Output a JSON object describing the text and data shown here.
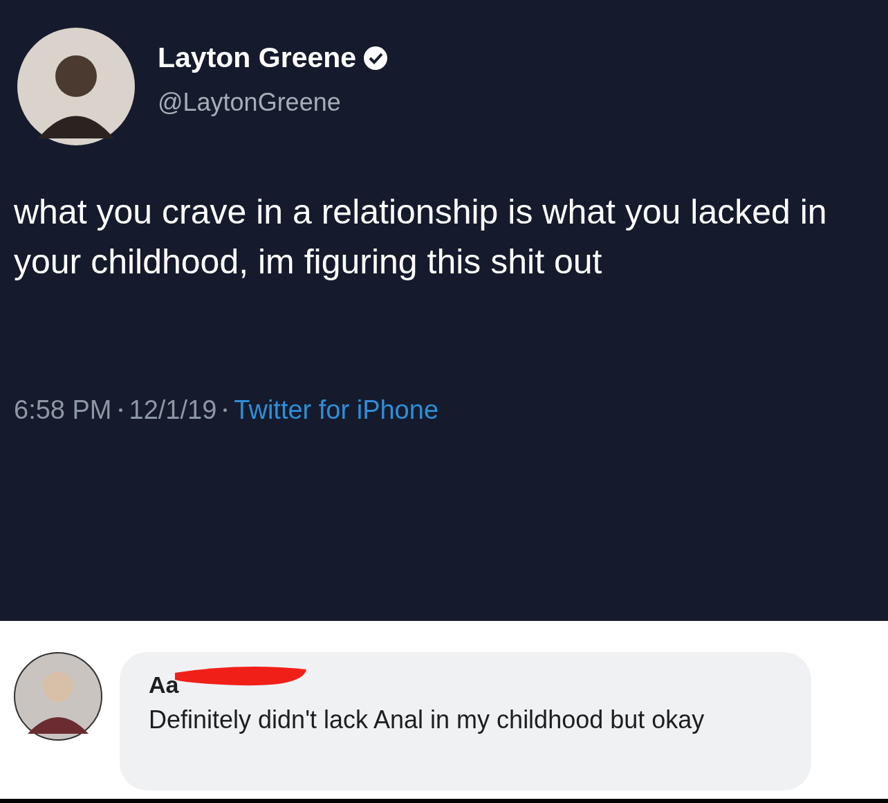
{
  "tweet": {
    "name": "Layton Greene",
    "verified": true,
    "handle": "@LaytonGreene",
    "text": "what you crave in a relationship is what you lacked in your childhood, im figuring this shit out",
    "time": "6:58 PM",
    "date": "12/1/19",
    "source": "Twitter for iPhone"
  },
  "comment": {
    "author": "Aa",
    "redacted": true,
    "text": "Definitely didn't lack Anal in my childhood but okay"
  }
}
